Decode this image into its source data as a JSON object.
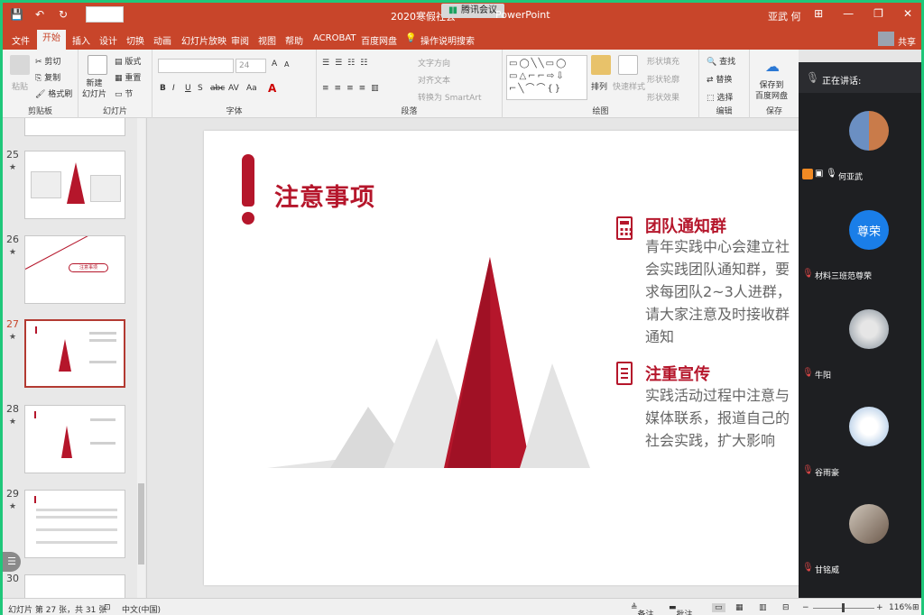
{
  "window": {
    "doc_title": "2020寒假社会",
    "app_suffix": "PowerPoint",
    "meeting_label": "腾讯会议",
    "user": "亚武 何",
    "controls": [
      "⊞",
      "—",
      "❐",
      "✕"
    ]
  },
  "quick_access": [
    "💾",
    "↶",
    "↻"
  ],
  "tabs": [
    "文件",
    "开始",
    "插入",
    "设计",
    "切换",
    "动画",
    "幻灯片放映",
    "审阅",
    "视图",
    "帮助",
    "ACROBAT",
    "百度网盘",
    "操作说明搜索"
  ],
  "active_tab": "开始",
  "share_label": "共享",
  "ribbon": {
    "clipboard": {
      "paste": "粘贴",
      "cut": "剪切",
      "copy": "复制",
      "format_painter": "格式刷",
      "label": "剪贴板"
    },
    "slides": {
      "new_slide": "新建\n幻灯片",
      "layout": "版式",
      "reset": "重置",
      "section": "节",
      "label": "幻灯片"
    },
    "font": {
      "size": "24",
      "label": "字体",
      "buttons": [
        "B",
        "I",
        "U",
        "S",
        "abc",
        "AV",
        "Aa",
        "A",
        "A"
      ]
    },
    "paragraph": {
      "text_direction": "文字方向",
      "align_text": "对齐文本",
      "smartart": "转换为 SmartArt",
      "label": "段落"
    },
    "drawing": {
      "arrange": "排列",
      "quick_styles": "快速样式",
      "fill": "形状填充",
      "outline": "形状轮廓",
      "effects": "形状效果",
      "label": "绘图"
    },
    "editing": {
      "find": "查找",
      "replace": "替换",
      "select": "选择",
      "label": "编辑"
    },
    "save": {
      "save_to_baidu": "保存到\n百度网盘",
      "label": "保存"
    }
  },
  "thumbnails": [
    {
      "num": "25"
    },
    {
      "num": "26",
      "caption": "注意事项"
    },
    {
      "num": "27",
      "current": true
    },
    {
      "num": "28"
    },
    {
      "num": "29"
    },
    {
      "num": "30"
    }
  ],
  "slide": {
    "title": "注意事项",
    "items": [
      {
        "heading": "团队通知群",
        "body": "青年实践中心会建立社会实践团队通知群，要求每团队2~3人进群，请大家注意及时接收群通知"
      },
      {
        "heading": "注重宣传",
        "body": "实践活动过程中注意与媒体联系，报道自己的社会实践，扩大影响"
      }
    ],
    "accent_color": "#b5162b"
  },
  "meeting": {
    "speaking_label": "正在讲话:",
    "participants": [
      {
        "name": "何亚武"
      },
      {
        "name": "材料三班范尊荣",
        "avatar_text": "尊荣"
      },
      {
        "name": "牛阳"
      },
      {
        "name": "谷雨豪"
      },
      {
        "name": "甘铭威"
      }
    ]
  },
  "status": {
    "slide_info": "幻灯片 第 27 张，共 31 张",
    "language": "中文(中国)",
    "notes": "备注",
    "comments": "批注",
    "zoom": "116%"
  }
}
